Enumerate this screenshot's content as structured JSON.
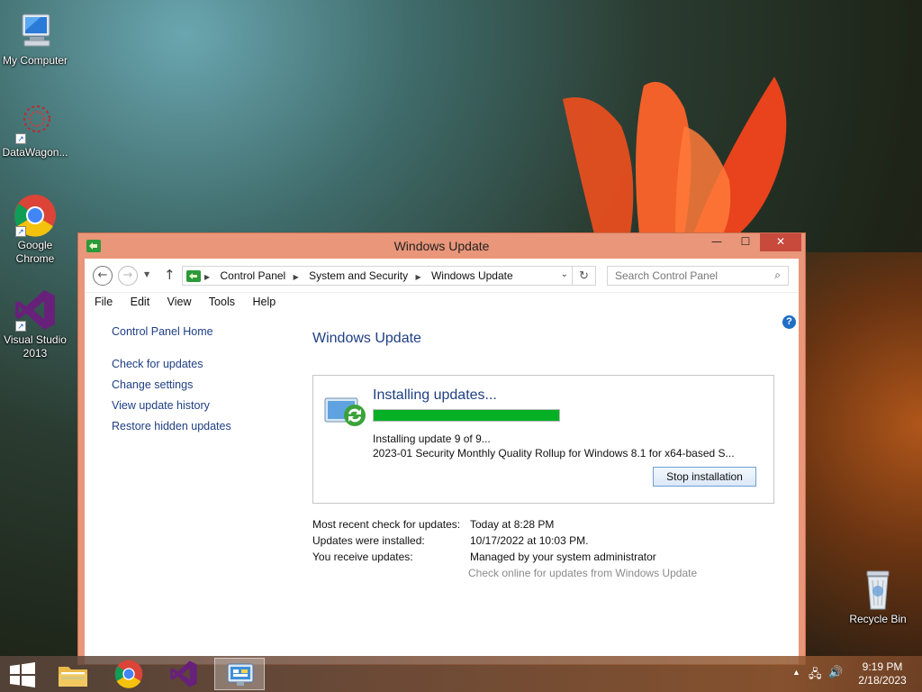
{
  "desktop": {
    "icons": [
      {
        "label": "My Computer"
      },
      {
        "label": "DataWagon..."
      },
      {
        "label": "Google Chrome"
      },
      {
        "label": "Visual Studio 2013"
      },
      {
        "label": "Recycle Bin"
      }
    ]
  },
  "window": {
    "title": "Windows Update",
    "controls": {
      "minimize": "—",
      "maximize": "☐",
      "close": "✕"
    },
    "address": {
      "crumbs": [
        "Control Panel",
        "System and Security",
        "Windows Update"
      ]
    },
    "search_placeholder": "Search Control Panel",
    "menu": [
      "File",
      "Edit",
      "View",
      "Tools",
      "Help"
    ]
  },
  "leftnav": {
    "home": "Control Panel Home",
    "items": [
      "Check for updates",
      "Change settings",
      "View update history",
      "Restore hidden updates"
    ]
  },
  "main": {
    "heading": "Windows Update",
    "status": {
      "title": "Installing updates...",
      "progress": 1.0,
      "line1": "Installing update 9 of 9...",
      "line2": "2023-01 Security Monthly Quality Rollup for Windows 8.1 for x64-based S...",
      "button": "Stop installation"
    },
    "info": [
      {
        "key": "Most recent check for updates:",
        "value": "Today at 8:28 PM"
      },
      {
        "key": "Updates were installed:",
        "value": "10/17/2022 at 10:03 PM."
      },
      {
        "key": "You receive updates:",
        "value": "Managed by your system administrator"
      }
    ],
    "online_link": "Check online for updates from Windows Update"
  },
  "taskbar": {
    "time": "9:19 PM",
    "date": "2/18/2023"
  },
  "colors": {
    "link": "#1e3f84",
    "progress": "#06b025",
    "window_frame": "#e9967a",
    "close": "#c74a3d"
  }
}
